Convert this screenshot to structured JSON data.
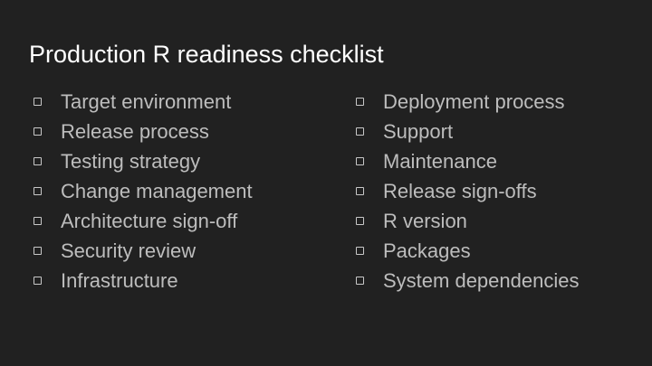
{
  "slide": {
    "title": "Production R readiness checklist",
    "left_items": [
      "Target environment",
      "Release process",
      "Testing strategy",
      "Change management",
      "Architecture sign-off",
      "Security review",
      "Infrastructure"
    ],
    "right_items": [
      "Deployment process",
      "Support",
      "Maintenance",
      "Release sign-offs",
      "R version",
      "Packages",
      "System dependencies"
    ]
  },
  "icons": {
    "checkbox": "empty-checkbox-icon"
  },
  "colors": {
    "background": "#212121",
    "title": "#ffffff",
    "item_text": "#bdbdbd"
  }
}
